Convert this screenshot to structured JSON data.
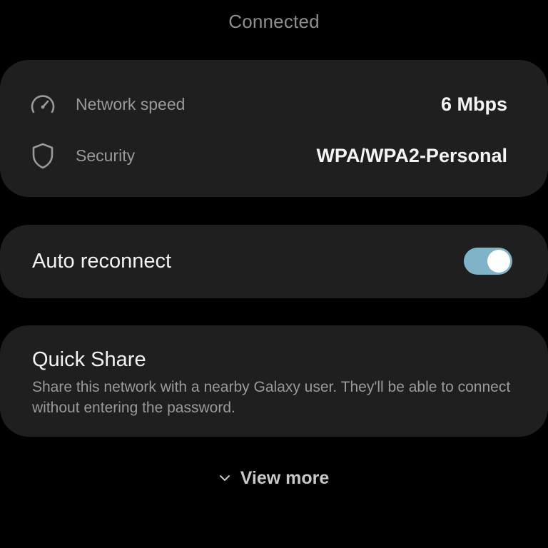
{
  "header": {
    "status": "Connected"
  },
  "network_info": {
    "speed": {
      "icon": "speedometer-icon",
      "label": "Network speed",
      "value": "6 Mbps"
    },
    "security": {
      "icon": "shield-icon",
      "label": "Security",
      "value": "WPA/WPA2-Personal"
    }
  },
  "auto_reconnect": {
    "label": "Auto reconnect",
    "enabled": true,
    "toggle_color": "#7fb3c8"
  },
  "quick_share": {
    "title": "Quick Share",
    "description": "Share this network with a nearby Galaxy user. They'll be able to connect without entering the password."
  },
  "footer": {
    "view_more_label": "View more",
    "icon": "chevron-down-icon"
  }
}
